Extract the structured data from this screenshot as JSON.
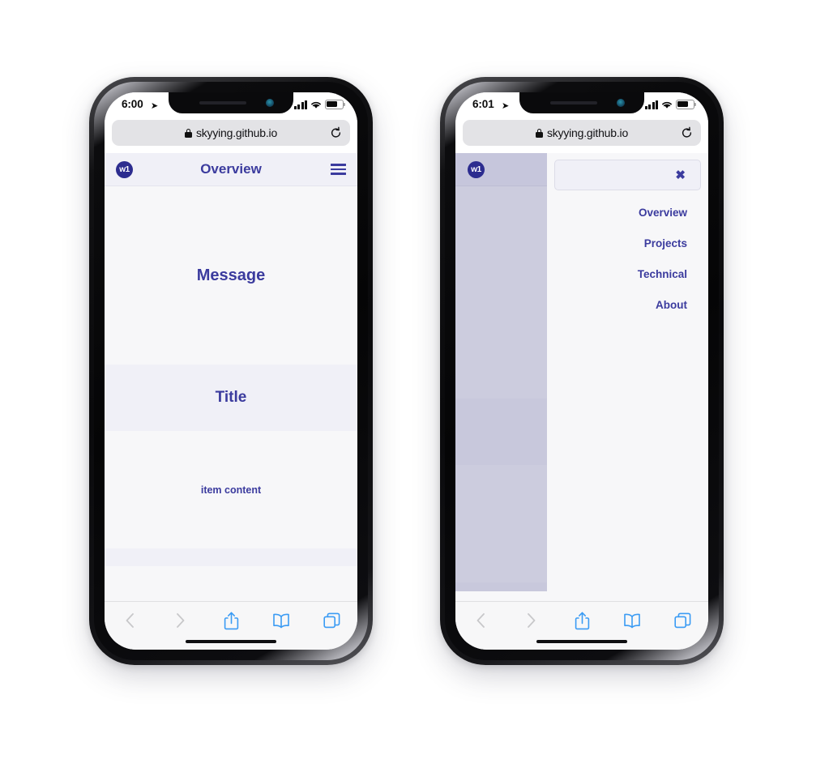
{
  "phones": [
    {
      "id": "phone-left",
      "state_label": "menu-closed",
      "status": {
        "time": "6:00",
        "location_arrow": "➤"
      },
      "browser": {
        "url": "skyying.github.io",
        "lock_icon": "lock-icon",
        "reload_icon": "reload-icon"
      },
      "site": {
        "logo": "w1",
        "title": "Overview",
        "menu_icon": "hamburger-icon",
        "sections": [
          {
            "name": "message",
            "text": "Message"
          },
          {
            "name": "title",
            "text": "Title"
          },
          {
            "name": "item",
            "text": "item content"
          }
        ]
      },
      "toolbar": {
        "back": "back-icon",
        "forward": "forward-icon",
        "share": "share-icon",
        "bookmarks": "bookmarks-icon",
        "tabs": "tabs-icon"
      }
    },
    {
      "id": "phone-right",
      "state_label": "menu-open",
      "status": {
        "time": "6:01",
        "location_arrow": "➤"
      },
      "browser": {
        "url": "skyying.github.io",
        "lock_icon": "lock-icon",
        "reload_icon": "reload-icon"
      },
      "site": {
        "logo": "w1",
        "close_label": "✖",
        "menu_items": [
          {
            "label": "Overview"
          },
          {
            "label": "Projects"
          },
          {
            "label": "Technical"
          },
          {
            "label": "About"
          }
        ]
      },
      "toolbar": {
        "back": "back-icon",
        "forward": "forward-icon",
        "share": "share-icon",
        "bookmarks": "bookmarks-icon",
        "tabs": "tabs-icon"
      }
    }
  ],
  "colors": {
    "brand_indigo": "#3b3b9e",
    "logo_navy": "#2c2c8f",
    "band_lavender": "#f0f0f7",
    "page_bg": "#f7f7f9",
    "scrim_lavender": "#ccccde",
    "safari_blue": "#3a9bf4"
  }
}
